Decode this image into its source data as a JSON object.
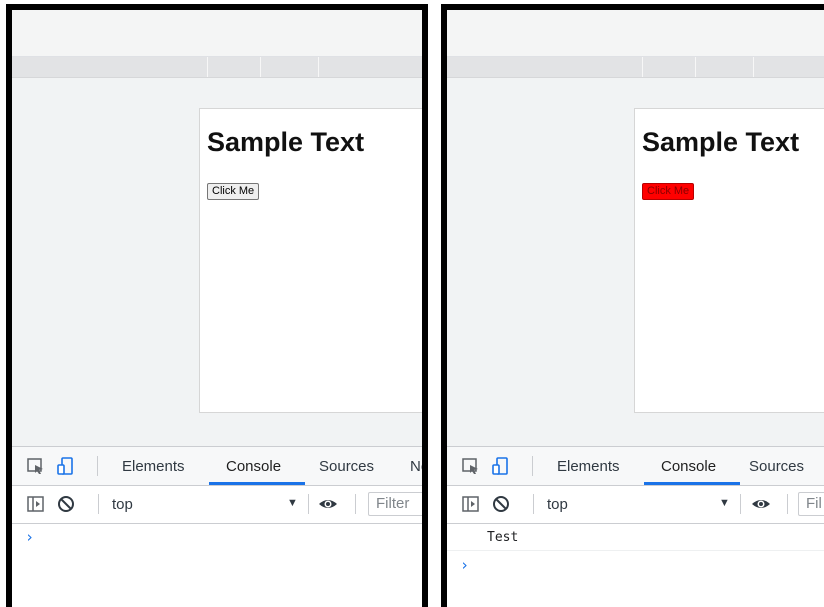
{
  "page": {
    "heading": "Sample Text",
    "button_label": "Click Me"
  },
  "devtools": {
    "tabs": [
      "Elements",
      "Console",
      "Sources",
      "Ne"
    ],
    "right_tabs": [
      "Elements",
      "Console",
      "Sources"
    ],
    "context": "top",
    "filter_placeholder": "Filter",
    "filter_placeholder_cut": "Fil",
    "prompt_symbol": "›",
    "caret_symbol": "▼"
  },
  "console_output": [
    "Test"
  ],
  "colors": {
    "button_clicked": "#ff0000",
    "accent": "#1a73e8"
  }
}
